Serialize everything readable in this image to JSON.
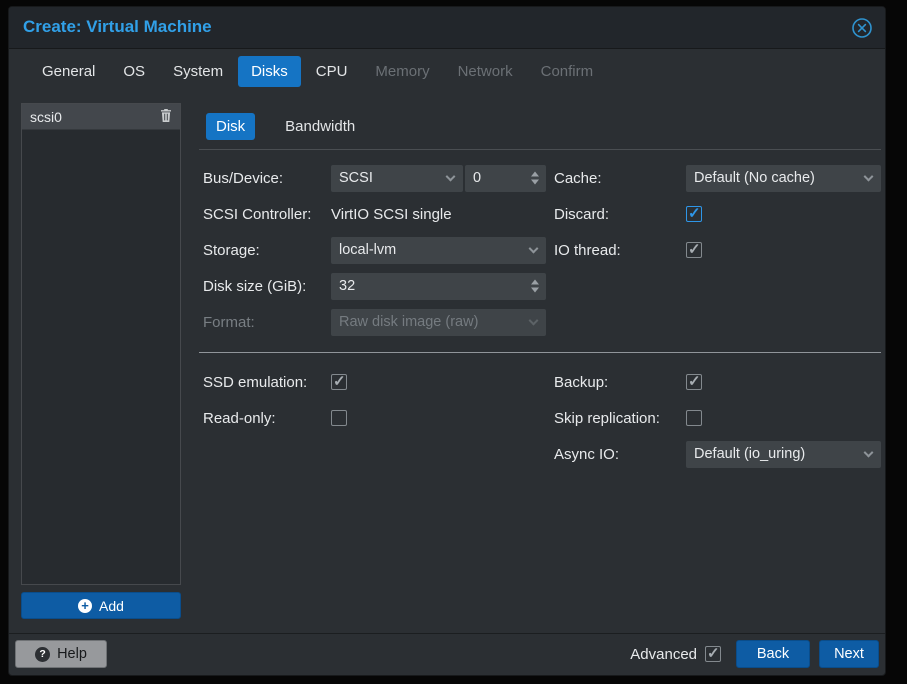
{
  "window": {
    "title": "Create: Virtual Machine"
  },
  "icons": {
    "close": "close-circle",
    "trash": "trash",
    "add_plus": "+",
    "help_q": "?"
  },
  "tabs": {
    "items": [
      {
        "label": "General",
        "state": "normal"
      },
      {
        "label": "OS",
        "state": "normal"
      },
      {
        "label": "System",
        "state": "normal"
      },
      {
        "label": "Disks",
        "state": "active"
      },
      {
        "label": "CPU",
        "state": "normal"
      },
      {
        "label": "Memory",
        "state": "disabled"
      },
      {
        "label": "Network",
        "state": "disabled"
      },
      {
        "label": "Confirm",
        "state": "disabled"
      }
    ]
  },
  "sidebar": {
    "items": [
      {
        "label": "scsi0",
        "selected": true
      }
    ],
    "add_label": "Add"
  },
  "subtabs": {
    "items": [
      {
        "label": "Disk",
        "active": true
      },
      {
        "label": "Bandwidth",
        "active": false
      }
    ]
  },
  "form": {
    "bus_device": {
      "label": "Bus/Device:",
      "bus": "SCSI",
      "device": "0"
    },
    "cache": {
      "label": "Cache:",
      "value": "Default (No cache)"
    },
    "scsi_controller": {
      "label": "SCSI Controller:",
      "value": "VirtIO SCSI single"
    },
    "discard": {
      "label": "Discard:",
      "checked": true
    },
    "storage": {
      "label": "Storage:",
      "value": "local-lvm"
    },
    "io_thread": {
      "label": "IO thread:",
      "checked": true
    },
    "disk_size": {
      "label": "Disk size (GiB):",
      "value": "32"
    },
    "format": {
      "label": "Format:",
      "value": "Raw disk image (raw)",
      "disabled": true
    },
    "ssd_emulation": {
      "label": "SSD emulation:",
      "checked": true
    },
    "backup": {
      "label": "Backup:",
      "checked": true
    },
    "read_only": {
      "label": "Read-only:",
      "checked": false
    },
    "skip_replication": {
      "label": "Skip replication:",
      "checked": false
    },
    "async_io": {
      "label": "Async IO:",
      "value": "Default (io_uring)"
    }
  },
  "footer": {
    "help": "Help",
    "advanced": {
      "label": "Advanced",
      "checked": true
    },
    "back": "Back",
    "next": "Next"
  },
  "colors": {
    "accent": "#1574c4",
    "button": "#0e5ca4",
    "title": "#31a0e8",
    "checked_accent": "#2e96e8"
  }
}
